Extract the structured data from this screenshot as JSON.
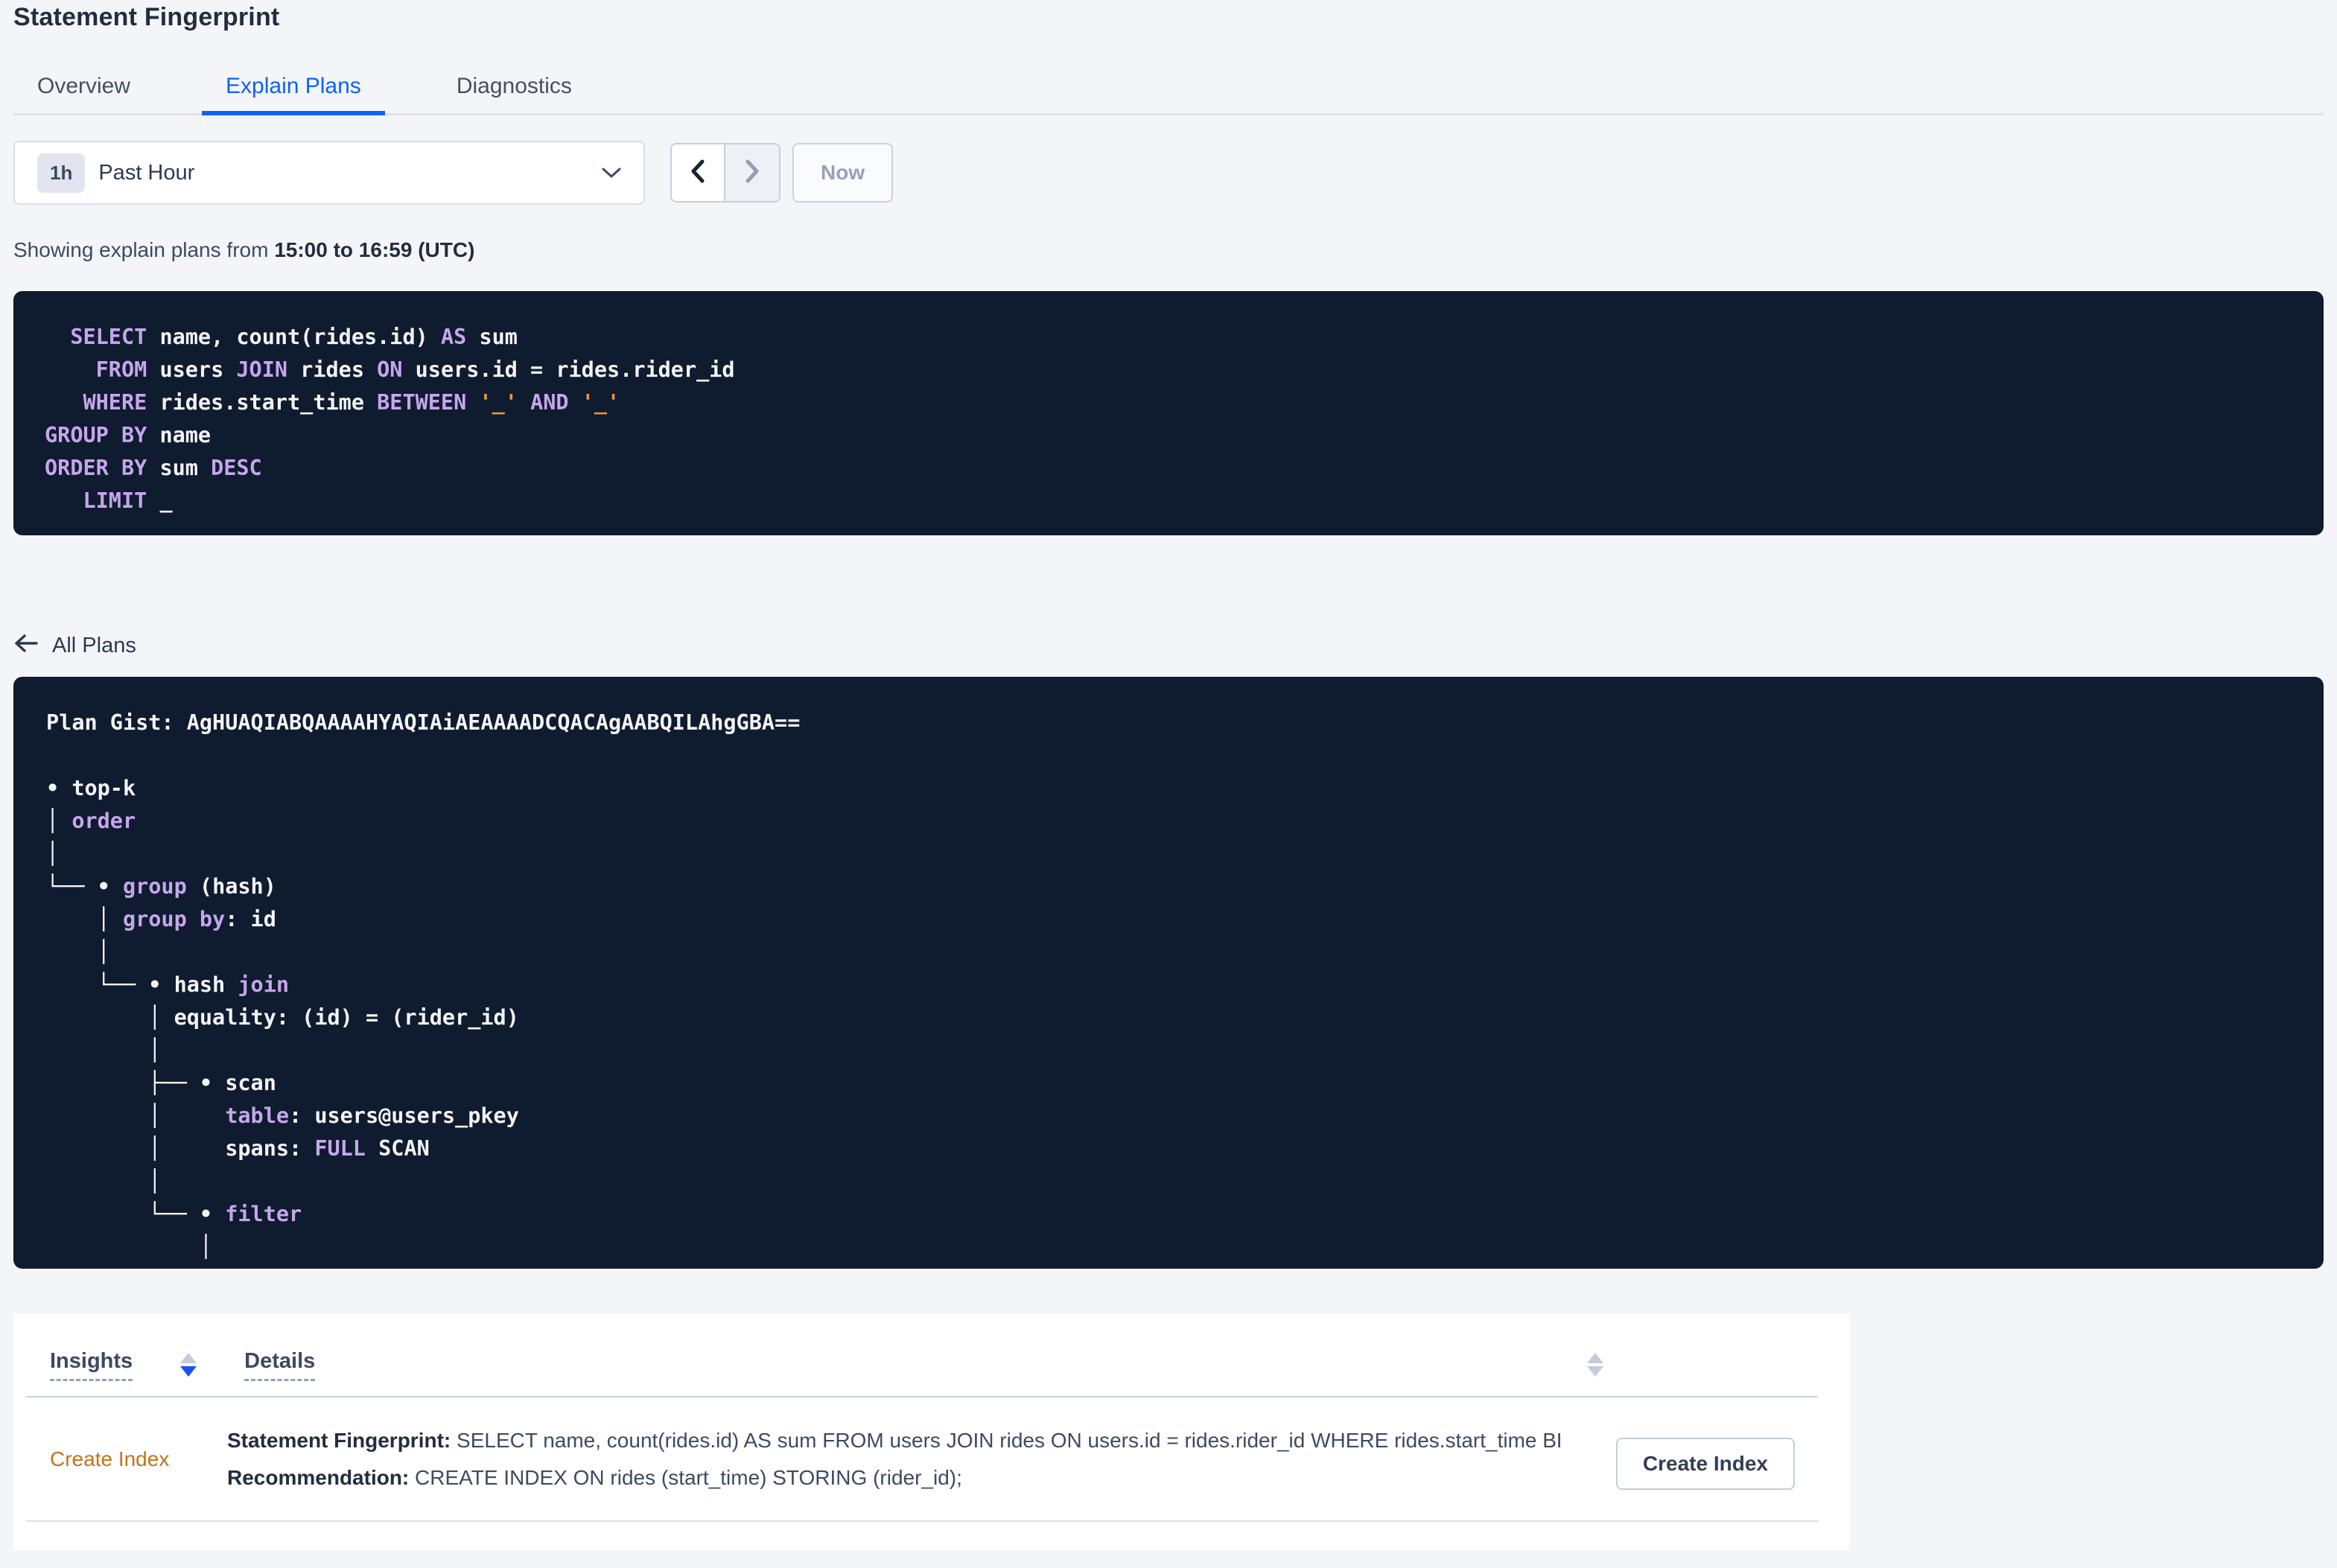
{
  "page": {
    "title": "Statement Fingerprint"
  },
  "tabs": [
    {
      "label": "Overview",
      "active": false
    },
    {
      "label": "Explain Plans",
      "active": true
    },
    {
      "label": "Diagnostics",
      "active": false
    }
  ],
  "time_controls": {
    "badge": "1h",
    "range_label": "Past Hour",
    "prev_icon": "chevron-left-icon",
    "next_icon": "chevron-right-icon",
    "now_label": "Now"
  },
  "caption": {
    "prefix": "Showing explain plans from ",
    "bold": "15:00 to 16:59 (UTC)"
  },
  "sql_statement": [
    [
      {
        "t": "  ",
        "c": "p"
      },
      {
        "t": "SELECT",
        "c": "k"
      },
      {
        "t": " name, count(rides.id) ",
        "c": "p"
      },
      {
        "t": "AS",
        "c": "k"
      },
      {
        "t": " sum",
        "c": "p"
      }
    ],
    [
      {
        "t": "    ",
        "c": "p"
      },
      {
        "t": "FROM",
        "c": "k"
      },
      {
        "t": " users ",
        "c": "p"
      },
      {
        "t": "JOIN",
        "c": "k"
      },
      {
        "t": " rides ",
        "c": "p"
      },
      {
        "t": "ON",
        "c": "k"
      },
      {
        "t": " users.id = rides.rider_id",
        "c": "p"
      }
    ],
    [
      {
        "t": "   ",
        "c": "p"
      },
      {
        "t": "WHERE",
        "c": "k"
      },
      {
        "t": " rides.start_time ",
        "c": "p"
      },
      {
        "t": "BETWEEN",
        "c": "k"
      },
      {
        "t": " ",
        "c": "p"
      },
      {
        "t": "'_'",
        "c": "o"
      },
      {
        "t": " ",
        "c": "p"
      },
      {
        "t": "AND",
        "c": "k"
      },
      {
        "t": " ",
        "c": "p"
      },
      {
        "t": "'_'",
        "c": "o"
      }
    ],
    [
      {
        "t": "GROUP BY",
        "c": "k"
      },
      {
        "t": " name",
        "c": "p"
      }
    ],
    [
      {
        "t": "ORDER BY",
        "c": "k"
      },
      {
        "t": " sum ",
        "c": "p"
      },
      {
        "t": "DESC",
        "c": "k"
      }
    ],
    [
      {
        "t": "   ",
        "c": "p"
      },
      {
        "t": "LIMIT",
        "c": "k"
      },
      {
        "t": " _",
        "c": "p"
      }
    ]
  ],
  "all_plans_label": "All Plans",
  "plan": [
    [
      {
        "t": "Plan Gist: AgHUAQIABQAAAAHYAQIAiAEAAAADCQACAgAABQILAhgGBA==",
        "c": "p"
      }
    ],
    [
      {
        "t": "",
        "c": "p"
      }
    ],
    [
      {
        "t": "• top-k",
        "c": "p"
      }
    ],
    [
      {
        "t": "│ ",
        "c": "p"
      },
      {
        "t": "order",
        "c": "k"
      }
    ],
    [
      {
        "t": "│",
        "c": "p"
      }
    ],
    [
      {
        "t": "└── • ",
        "c": "p"
      },
      {
        "t": "group",
        "c": "k"
      },
      {
        "t": " (hash)",
        "c": "p"
      }
    ],
    [
      {
        "t": "    │ ",
        "c": "p"
      },
      {
        "t": "group by",
        "c": "k"
      },
      {
        "t": ": id",
        "c": "p"
      }
    ],
    [
      {
        "t": "    │",
        "c": "p"
      }
    ],
    [
      {
        "t": "    └── • hash ",
        "c": "p"
      },
      {
        "t": "join",
        "c": "k"
      }
    ],
    [
      {
        "t": "        │ equality: (id) = (rider_id)",
        "c": "p"
      }
    ],
    [
      {
        "t": "        │",
        "c": "p"
      }
    ],
    [
      {
        "t": "        ├── • scan",
        "c": "p"
      }
    ],
    [
      {
        "t": "        │     ",
        "c": "p"
      },
      {
        "t": "table",
        "c": "k"
      },
      {
        "t": ": users@users_pkey",
        "c": "p"
      }
    ],
    [
      {
        "t": "        │     spans: ",
        "c": "p"
      },
      {
        "t": "FULL",
        "c": "k"
      },
      {
        "t": " SCAN",
        "c": "p"
      }
    ],
    [
      {
        "t": "        │",
        "c": "p"
      }
    ],
    [
      {
        "t": "        └── • ",
        "c": "p"
      },
      {
        "t": "filter",
        "c": "k"
      }
    ],
    [
      {
        "t": "            │",
        "c": "p"
      }
    ]
  ],
  "insights_table": {
    "headers": [
      {
        "label": "Insights",
        "sort": "desc"
      },
      {
        "label": "Details",
        "sort": "none"
      }
    ],
    "row": {
      "insight_link": "Create Index",
      "details": [
        {
          "bold": "Statement Fingerprint:",
          "text": " SELECT name, count(rides.id) AS sum FROM users JOIN rides ON users.id = rides.rider_id WHERE rides.start_time BETWEEN '_…"
        },
        {
          "bold": "Recommendation:",
          "text": " CREATE INDEX ON rides (start_time) STORING (rider_id);"
        }
      ],
      "action_label": "Create Index"
    }
  },
  "colors": {
    "page_bg": "#f4f5f9",
    "code_bg": "#0f1b2e",
    "code_text": "#f2f4fa",
    "code_keyword": "#c5a6ec",
    "code_literal": "#ef9240",
    "accent_blue": "#0d63f5",
    "sort_active_blue": "#1556f0",
    "link_orange": "#c37317",
    "heading_text": "#242d3e"
  }
}
